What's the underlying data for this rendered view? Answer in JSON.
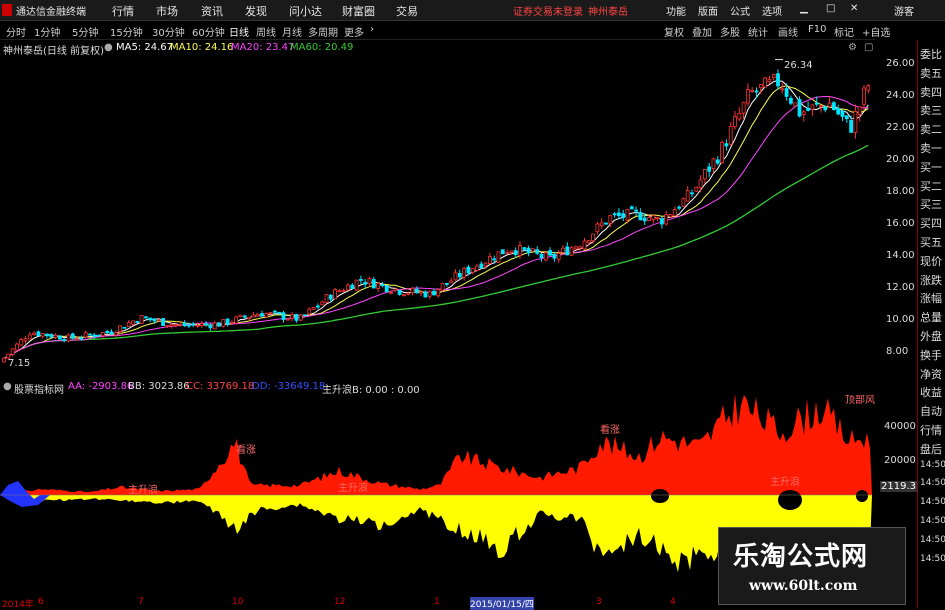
{
  "menubar": {
    "app_title": "通达信金融终端",
    "menus": [
      "行情",
      "市场",
      "资讯",
      "发现",
      "问小达",
      "财富圈",
      "交易"
    ],
    "notice": "证券交易未登录",
    "stock_name": "神州泰岳",
    "right_menus": [
      "功能",
      "版面",
      "公式",
      "选项"
    ],
    "guest": "游客"
  },
  "periodbar": {
    "periods": [
      "分时",
      "1分钟",
      "5分钟",
      "15分钟",
      "30分钟",
      "60分钟",
      "日线",
      "周线",
      "月线",
      "多周期",
      "更多"
    ],
    "active": "日线",
    "tools": [
      "复权",
      "叠加",
      "多股",
      "统计",
      "画线",
      "F10",
      "标记",
      "+自选"
    ]
  },
  "infobar": {
    "title": "神州泰岳(日线 前复权)",
    "ma5": "MA5: 24.67",
    "ma10": "MA10: 24.16",
    "ma20": "MA20: 23.47",
    "ma60": "MA60: 20.49"
  },
  "price_axis": [
    "26.00",
    "24.00",
    "22.00",
    "20.00",
    "18.00",
    "16.00",
    "14.00",
    "12.00",
    "10.00",
    "8.00"
  ],
  "price_annotations": {
    "high": "26.34",
    "low": "7.15"
  },
  "subbar": {
    "title": "股票指标网",
    "aa": "AA: -2903.86",
    "bb": "BB: 3023.86",
    "cc": "CC: 33769.18",
    "dd": "DD: -33649.18",
    "b": "主升浪B: 0.00 : 0.00"
  },
  "indicator_axis": [
    "40000",
    "20000",
    "0"
  ],
  "indicator_value": "2119.37",
  "indicator_labels": {
    "watch": "看涨",
    "wave": "主升浪",
    "top": "顶部风"
  },
  "right_panel": {
    "labels": [
      "委比",
      "卖五",
      "卖四",
      "卖三",
      "卖二",
      "卖一",
      "买一",
      "买二",
      "买三",
      "买四",
      "买五",
      "现价",
      "涨跌",
      "涨幅",
      "总量",
      "外盘",
      "换手",
      "净资",
      "收益",
      "自动",
      "行情",
      "盘后",
      "14:50",
      "14:50",
      "14:50",
      "14:50",
      "14:50",
      "14:50"
    ]
  },
  "datebar": {
    "dates": [
      "2014年",
      "6",
      "7",
      "10",
      "12",
      "1",
      "2015/01/15/四",
      "3",
      "4",
      "5"
    ]
  },
  "watermark": {
    "line1": "乐淘公式网",
    "line2": "www.60lt.com"
  },
  "colors": {
    "bg": "#000000",
    "up": "#ff3333",
    "down": "#00e5ff",
    "ma5": "#ffffff",
    "ma10": "#ffff55",
    "ma20": "#ff44ff",
    "ma60": "#33cc33",
    "area_red": "#ff1a00",
    "area_yellow": "#ffff00",
    "area_blue": "#2233ff"
  }
}
